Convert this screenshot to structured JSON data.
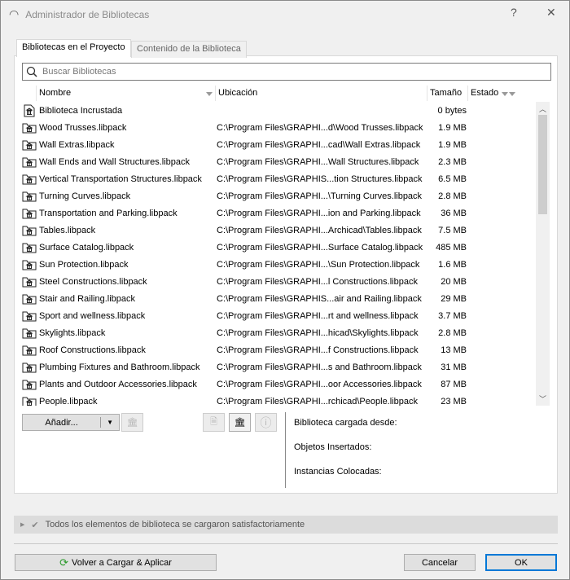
{
  "window": {
    "title": "Administrador de Bibliotecas",
    "help": "?",
    "close": "✕"
  },
  "tabs": [
    {
      "label": "Bibliotecas en el Proyecto"
    },
    {
      "label": "Contenido de la Biblioteca"
    }
  ],
  "search": {
    "placeholder": "Buscar Bibliotecas",
    "value": ""
  },
  "table": {
    "columns": [
      "Nombre",
      "Ubicación",
      "Tamaño",
      "Estado"
    ],
    "rows": [
      {
        "name": "Biblioteca Incrustada",
        "location": "",
        "size": "0 bytes",
        "icon": "embedded-library-icon"
      },
      {
        "name": "Wood Trusses.libpack",
        "location": "C:\\Program Files\\GRAPHI...d\\Wood Trusses.libpack",
        "size": "1.9 MB"
      },
      {
        "name": "Wall Extras.libpack",
        "location": "C:\\Program Files\\GRAPHI...cad\\Wall Extras.libpack",
        "size": "1.9 MB"
      },
      {
        "name": "Wall Ends and Wall Structures.libpack",
        "location": "C:\\Program Files\\GRAPHI...Wall Structures.libpack",
        "size": "2.3 MB"
      },
      {
        "name": "Vertical Transportation Structures.libpack",
        "location": "C:\\Program Files\\GRAPHIS...tion Structures.libpack",
        "size": "6.5 MB"
      },
      {
        "name": "Turning Curves.libpack",
        "location": "C:\\Program Files\\GRAPHI...\\Turning Curves.libpack",
        "size": "2.8 MB"
      },
      {
        "name": "Transportation and Parking.libpack",
        "location": "C:\\Program Files\\GRAPHI...ion and Parking.libpack",
        "size": "36 MB"
      },
      {
        "name": "Tables.libpack",
        "location": "C:\\Program Files\\GRAPHI...Archicad\\Tables.libpack",
        "size": "7.5 MB"
      },
      {
        "name": "Surface Catalog.libpack",
        "location": "C:\\Program Files\\GRAPHI...Surface Catalog.libpack",
        "size": "485 MB"
      },
      {
        "name": "Sun Protection.libpack",
        "location": "C:\\Program Files\\GRAPHI...\\Sun Protection.libpack",
        "size": "1.6 MB"
      },
      {
        "name": "Steel Constructions.libpack",
        "location": "C:\\Program Files\\GRAPHI...l Constructions.libpack",
        "size": "20 MB"
      },
      {
        "name": "Stair and Railing.libpack",
        "location": "C:\\Program Files\\GRAPHIS...air and Railing.libpack",
        "size": "29 MB"
      },
      {
        "name": "Sport and wellness.libpack",
        "location": "C:\\Program Files\\GRAPHI...rt and wellness.libpack",
        "size": "3.7 MB"
      },
      {
        "name": "Skylights.libpack",
        "location": "C:\\Program Files\\GRAPHI...hicad\\Skylights.libpack",
        "size": "2.8 MB"
      },
      {
        "name": "Roof Constructions.libpack",
        "location": "C:\\Program Files\\GRAPHI...f Constructions.libpack",
        "size": "13 MB"
      },
      {
        "name": "Plumbing Fixtures and Bathroom.libpack",
        "location": "C:\\Program Files\\GRAPHI...s and Bathroom.libpack",
        "size": "31 MB"
      },
      {
        "name": "Plants and Outdoor Accessories.libpack",
        "location": "C:\\Program Files\\GRAPHI...oor Accessories.libpack",
        "size": "87 MB"
      },
      {
        "name": "People.libpack",
        "location": "C:\\Program Files\\GRAPHI...rchicad\\People.libpack",
        "size": "23 MB"
      }
    ]
  },
  "actions": {
    "add": "Añadir..."
  },
  "info": {
    "loaded_from": "Biblioteca cargada desde:",
    "inserted": "Objetos Insertados:",
    "placed": "Instancias Colocadas:"
  },
  "status": {
    "message": "Todos los elementos de biblioteca se cargaron satisfactoriamente"
  },
  "footer": {
    "reload": "Volver a Cargar & Aplicar",
    "cancel": "Cancelar",
    "ok": "OK"
  }
}
